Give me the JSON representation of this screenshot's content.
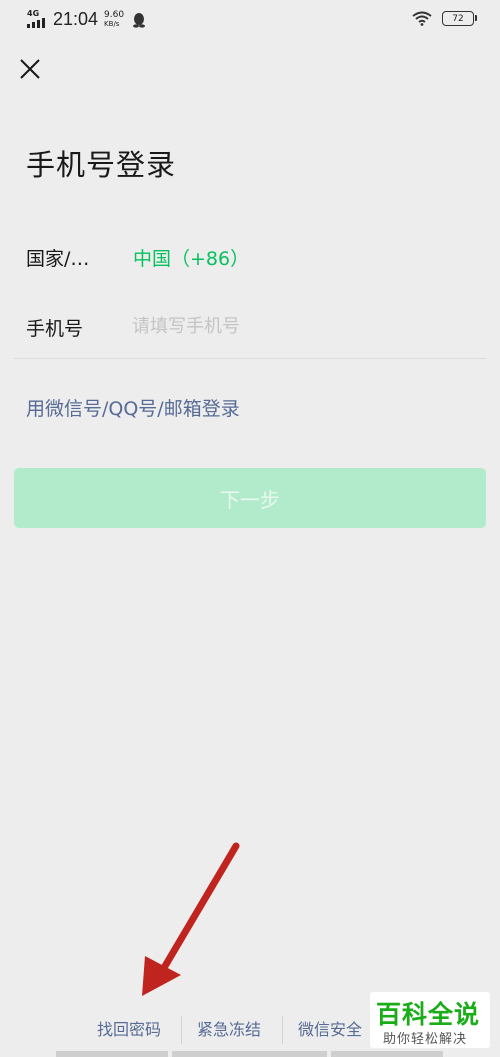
{
  "status_bar": {
    "network_type": "4G",
    "time": "21:04",
    "speed_value": "9.60",
    "speed_unit": "KB/s",
    "battery": "72"
  },
  "header": {
    "close_icon": "close-icon"
  },
  "page": {
    "title": "手机号登录",
    "country_label": "国家/…",
    "country_value": "中国（+86）",
    "phone_label": "手机号",
    "phone_placeholder": "请填写手机号",
    "alt_login": "用微信号/QQ号/邮箱登录",
    "next_button": "下一步"
  },
  "footer": {
    "links": [
      "找回密码",
      "紧急冻结",
      "微信安全"
    ]
  },
  "watermark": {
    "main": "百科全说",
    "sub": "助你轻松解决"
  },
  "colors": {
    "accent_green": "#07c160",
    "link_blue": "#576b95",
    "button_disabled": "#b1ebcb",
    "background": "#ededed"
  }
}
